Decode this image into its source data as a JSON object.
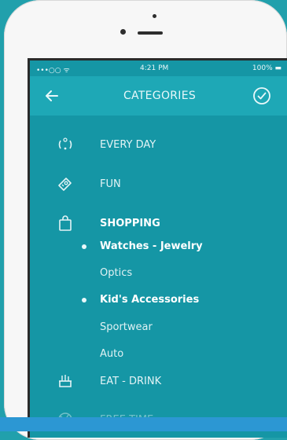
{
  "statusbar": {
    "signal": "•••○○ ᯤ",
    "time": "4:21 PM",
    "battery": "100% ▬"
  },
  "navbar": {
    "title": "CATEGORIES",
    "back_icon": "arrow-left-icon",
    "confirm_icon": "check-circle-icon"
  },
  "categories": [
    {
      "label": "EVERY DAY",
      "icon": "every-day-icon"
    },
    {
      "label": "FUN",
      "icon": "ticket-icon"
    },
    {
      "label": "SHOPPING",
      "icon": "shopping-bag-icon"
    },
    {
      "label": "EAT - DRINK",
      "icon": "food-icon"
    },
    {
      "label": "FREE TIME",
      "icon": "free-time-icon"
    }
  ],
  "shopping_sub": [
    {
      "label": "Watches - Jewelry",
      "selected": true
    },
    {
      "label": "Optics",
      "selected": false
    },
    {
      "label": "Kid's Accessories",
      "selected": true
    },
    {
      "label": "Sportwear",
      "selected": false
    },
    {
      "label": "Auto",
      "selected": false
    }
  ],
  "colors": {
    "background": "#21a0ac",
    "screen": "#1596a5",
    "navbar": "#1ea8b6"
  }
}
